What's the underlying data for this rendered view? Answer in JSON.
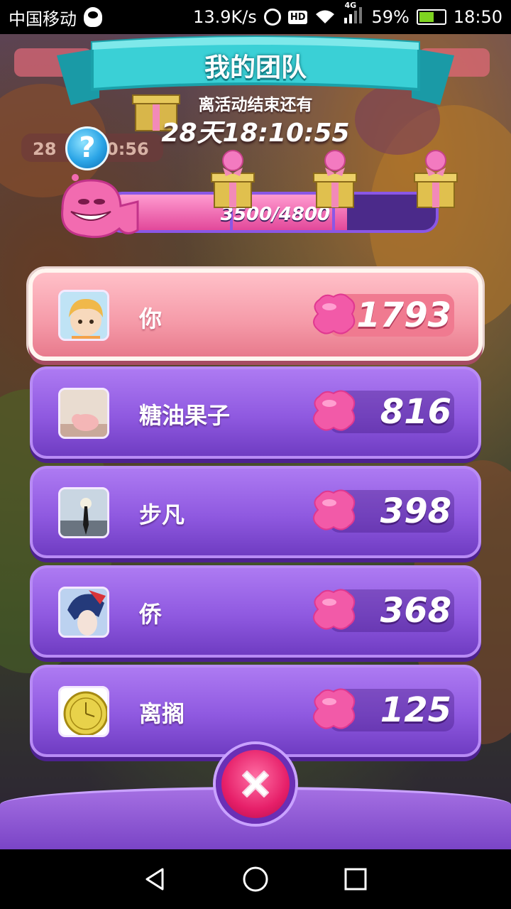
{
  "status_bar": {
    "carrier": "中国移动",
    "net_speed": "13.9K/s",
    "hd": "HD",
    "network_type": "4G",
    "battery": "59%",
    "battery_level": 0.59,
    "time": "18:50"
  },
  "header": {
    "title": "我的团队",
    "countdown_label": "离活动结束还有",
    "countdown": "28天18:10:55",
    "help": "?"
  },
  "progress": {
    "text": "3500/4800",
    "value": 3500,
    "max": 4800
  },
  "members": [
    {
      "name": "你",
      "score": "1793",
      "avatar": "blond-boy-avatar",
      "is_self": true
    },
    {
      "name": "糖油果子",
      "score": "816",
      "avatar": "piglet-photo-avatar",
      "is_self": false
    },
    {
      "name": "步凡",
      "score": "398",
      "avatar": "silhouette-photo-avatar",
      "is_self": false
    },
    {
      "name": "侨",
      "score": "368",
      "avatar": "anime-boy-avatar",
      "is_self": false
    },
    {
      "name": "离搁",
      "score": "125",
      "avatar": "gold-clock-avatar",
      "is_self": false
    }
  ],
  "colors": {
    "row_purple": "#9a66e8",
    "row_self": "#f59aa8",
    "candy_pink": "#f25aa8",
    "close_button": "#e61f69",
    "banner_teal": "#2fc6cc"
  }
}
